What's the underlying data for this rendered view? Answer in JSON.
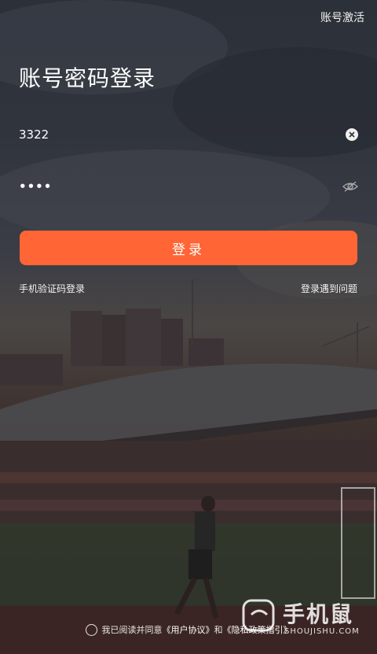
{
  "header": {
    "activate_label": "账号激活"
  },
  "page": {
    "title": "账号密码登录"
  },
  "form": {
    "account_value": "3322",
    "password_value": "••••"
  },
  "actions": {
    "login_label": "登录",
    "sms_login_label": "手机验证码登录",
    "login_problem_label": "登录遇到问题"
  },
  "agreement": {
    "prefix": "我已阅读并同意",
    "user_agreement": "《用户协议》",
    "and": "和",
    "privacy_guide": "《隐私政策指引》"
  },
  "watermark": {
    "main": "手机鼠",
    "sub": "SHOUJISHU.COM"
  },
  "colors": {
    "accent": "#ff6535"
  },
  "icons": {
    "clear": "clear-icon",
    "password_toggle": "eye-closed-icon",
    "agree": "radio-icon"
  }
}
